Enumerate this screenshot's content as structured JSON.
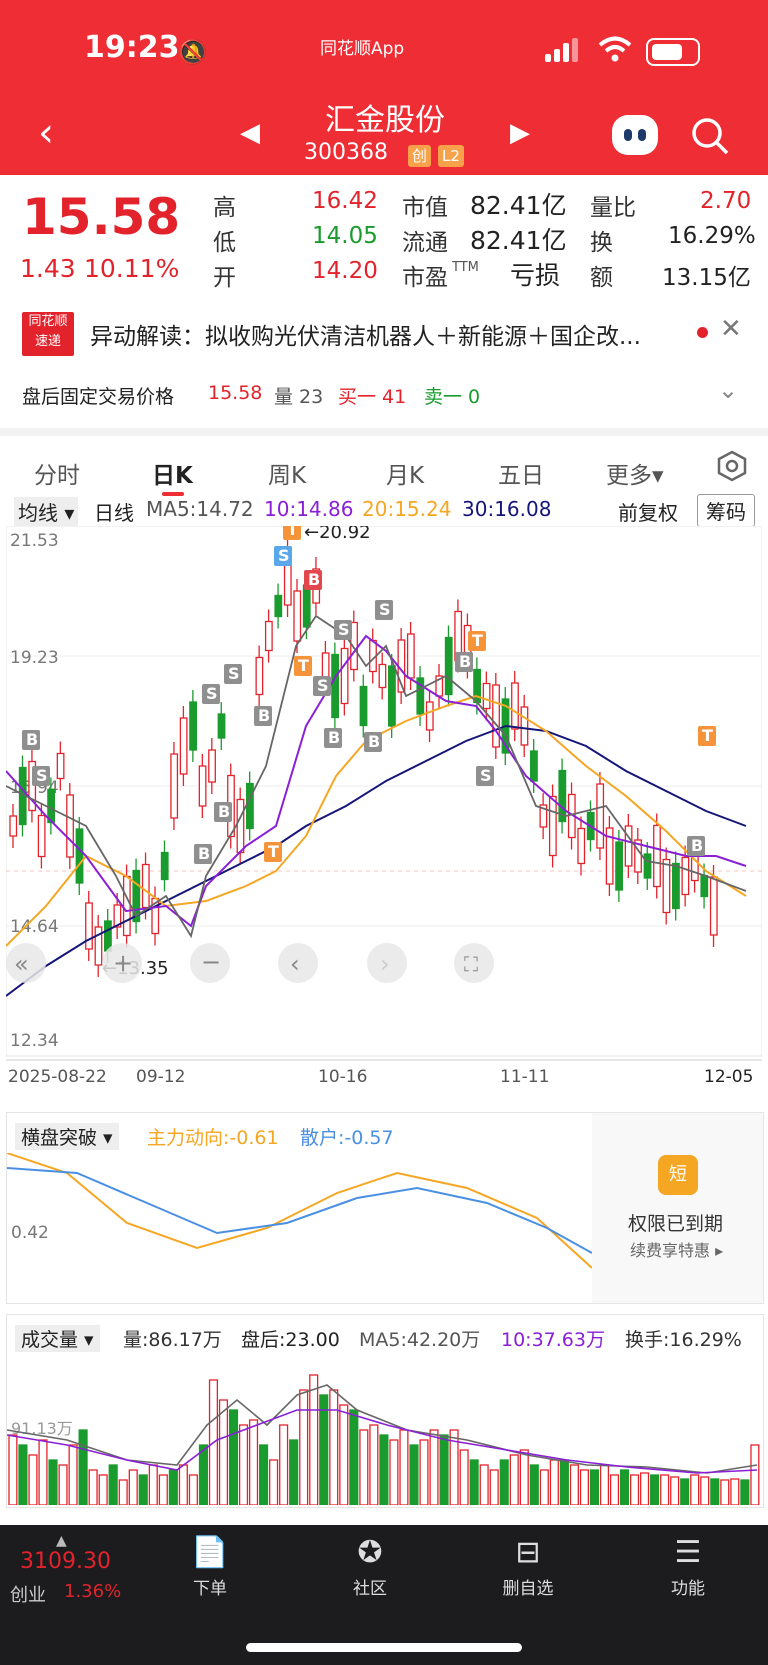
{
  "status_bar": {
    "time": "19:23",
    "app_name": "同花顺App"
  },
  "header": {
    "stock_name": "汇金股份",
    "stock_code": "300368",
    "badge_board": "创",
    "badge_level": "L2"
  },
  "quote": {
    "price": "15.58",
    "change": "1.43",
    "change_pct": "10.11%",
    "high_label": "高",
    "high": "16.42",
    "low_label": "低",
    "low": "14.05",
    "open_label": "开",
    "open": "14.20",
    "mcap_label": "市值",
    "mcap": "82.41亿",
    "float_label": "流通",
    "float": "82.41亿",
    "pe_label": "市盈",
    "pe_sup": "TTM",
    "pe": "亏损",
    "vol_ratio_label": "量比",
    "vol_ratio": "2.70",
    "turnover_label": "换",
    "turnover": "16.29%",
    "amount_label": "额",
    "amount": "13.15亿"
  },
  "alert": {
    "logo_line1": "同花顺",
    "logo_line2": "速递",
    "text": "异动解读：拟收购光伏清洁机器人＋新能源＋国企改..."
  },
  "fixed_trade": {
    "label": "盘后固定交易价格",
    "price": "15.58",
    "vol_label": "量 23",
    "buy": "买一 41",
    "sell": "卖一 0"
  },
  "tabs": [
    "分时",
    "日K",
    "周K",
    "月K",
    "五日",
    "更多▾"
  ],
  "ma": {
    "selector": "均线 ▾",
    "period": "日线",
    "ma5": "MA5:14.72",
    "ma10": "10:14.86",
    "ma20": "20:15.24",
    "ma30": "30:16.08",
    "adjust": "前复权",
    "chip": "筹码"
  },
  "kline": {
    "y_labels": [
      "21.53",
      "19.23",
      "16.94",
      "14.64",
      "12.34"
    ],
    "high_marker": "←20.92",
    "low_marker": "←13.35",
    "x_labels": [
      "2025-08-22",
      "09-12",
      "10-16",
      "11-11",
      "12-05"
    ]
  },
  "indicator": {
    "selector": "横盘突破 ▾",
    "main_force": "主力动向:-0.61",
    "retail": "散户:-0.57",
    "level": "0.42",
    "expired_title": "权限已到期",
    "expired_sub": "续费享特惠 ▸",
    "short_badge": "短"
  },
  "volume": {
    "selector": "成交量 ▾",
    "vol": "量:86.17万",
    "after": "盘后:23.00",
    "ma5": "MA5:42.20万",
    "ma10": "10:37.63万",
    "turnover": "换手:16.29%",
    "level": "91.13万"
  },
  "nav": {
    "index_value": "3109.30",
    "index_name": "创业",
    "index_pct": "1.36%",
    "items": [
      "下单",
      "社区",
      "删自选",
      "功能"
    ]
  },
  "colors": {
    "accent": "#ee2d35",
    "up": "#e3232c",
    "down": "#1a9b2e"
  }
}
